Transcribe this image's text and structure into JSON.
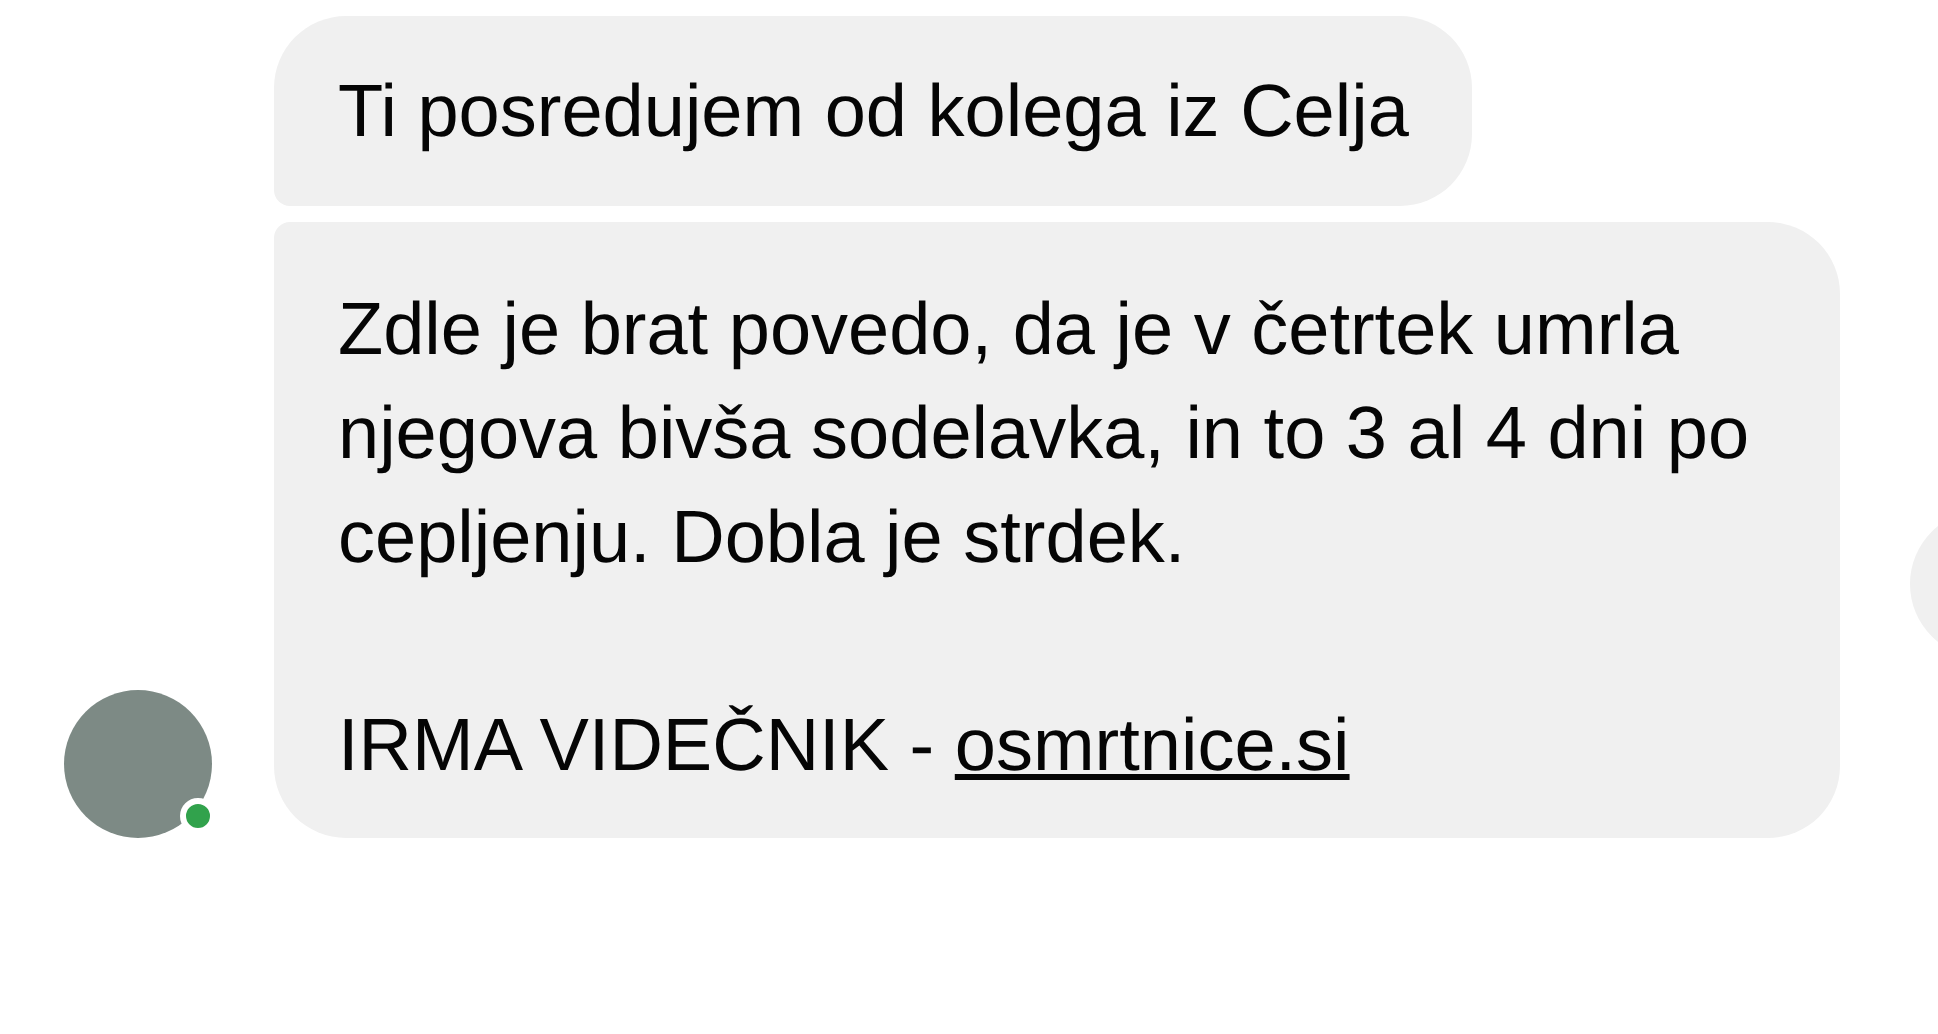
{
  "messages": [
    {
      "kind": "text",
      "text": "Ti posredujem od kolega iz Celja"
    },
    {
      "kind": "link_preview",
      "text": "Zdle je brat povedo, da je v četrtek umrla njegova bivša sodelavka, in to 3 al 4 dni po cepljenju. Dobla je strdek.",
      "caption": "IRMA VIDEČNIK - ",
      "link": "osmrtnice.si"
    }
  ],
  "sender": {
    "online": true
  }
}
